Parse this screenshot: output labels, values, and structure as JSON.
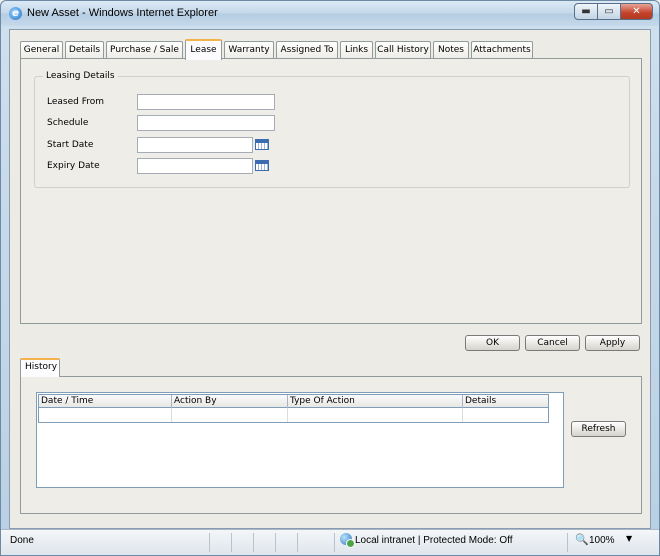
{
  "window": {
    "title": "New Asset - Windows Internet Explorer",
    "min_glyph": "▬",
    "max_glyph": "▭",
    "close_glyph": "✕"
  },
  "tabs": [
    {
      "label": "General"
    },
    {
      "label": "Details"
    },
    {
      "label": "Purchase / Sale"
    },
    {
      "label": "Lease",
      "active": true
    },
    {
      "label": "Warranty"
    },
    {
      "label": "Assigned To"
    },
    {
      "label": "Links"
    },
    {
      "label": "Call History"
    },
    {
      "label": "Notes"
    },
    {
      "label": "Attachments"
    }
  ],
  "leasing": {
    "group_title": "Leasing Details",
    "leased_from_label": "Leased From",
    "leased_from_value": "",
    "schedule_label": "Schedule",
    "schedule_value": "",
    "start_date_label": "Start Date",
    "start_date_value": "",
    "expiry_date_label": "Expiry Date",
    "expiry_date_value": ""
  },
  "actions": {
    "ok": "OK",
    "cancel": "Cancel",
    "apply": "Apply"
  },
  "history": {
    "tab_label": "History",
    "columns": [
      "Date / Time",
      "Action By",
      "Type Of Action",
      "Details"
    ],
    "refresh": "Refresh"
  },
  "statusbar": {
    "status": "Done",
    "zone": "Local intranet | Protected Mode: Off",
    "zoom": "100%",
    "zoom_glyph": "🔍",
    "dropdown_glyph": "▼"
  },
  "colors": {
    "active_tab_accent": "#f3b24a",
    "close_button": "#c4412a"
  }
}
